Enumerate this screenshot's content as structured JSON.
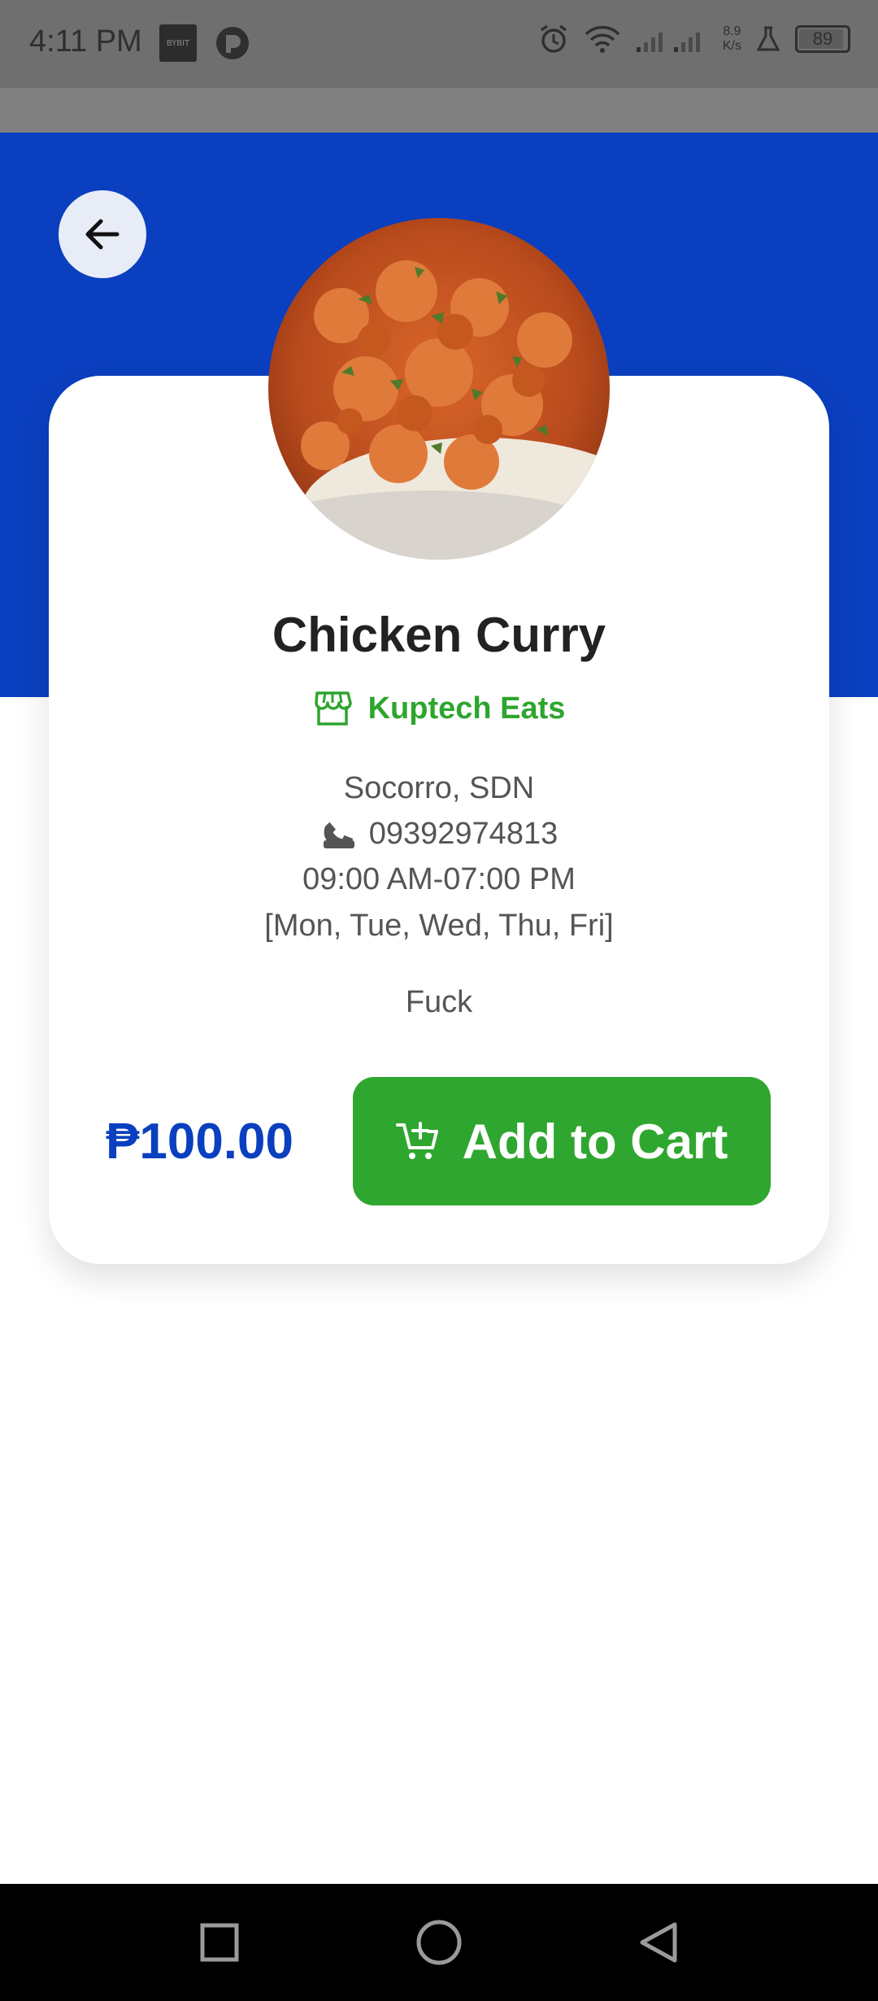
{
  "status_bar": {
    "time": "4:11 PM",
    "app_badge": "BYBIT",
    "net_speed_value": "8.9",
    "net_speed_unit": "K/s",
    "battery": "89"
  },
  "product": {
    "name": "Chicken Curry",
    "store_name": "Kuptech Eats",
    "location": "Socorro, SDN",
    "phone": "09392974813",
    "hours": "09:00 AM-07:00 PM",
    "days": "[Mon, Tue, Wed, Thu, Fri]",
    "description": "Fuck",
    "price": "₱100.00"
  },
  "actions": {
    "add_to_cart_label": "Add to Cart"
  },
  "colors": {
    "primary_blue": "#0a3fbf",
    "accent_green": "#2fa62f"
  },
  "icons": {
    "back": "arrow-left-icon",
    "store": "store-icon",
    "phone": "phone-icon",
    "cart": "add-to-cart-icon",
    "nav_recent": "square-icon",
    "nav_home": "circle-icon",
    "nav_back": "triangle-back-icon"
  }
}
